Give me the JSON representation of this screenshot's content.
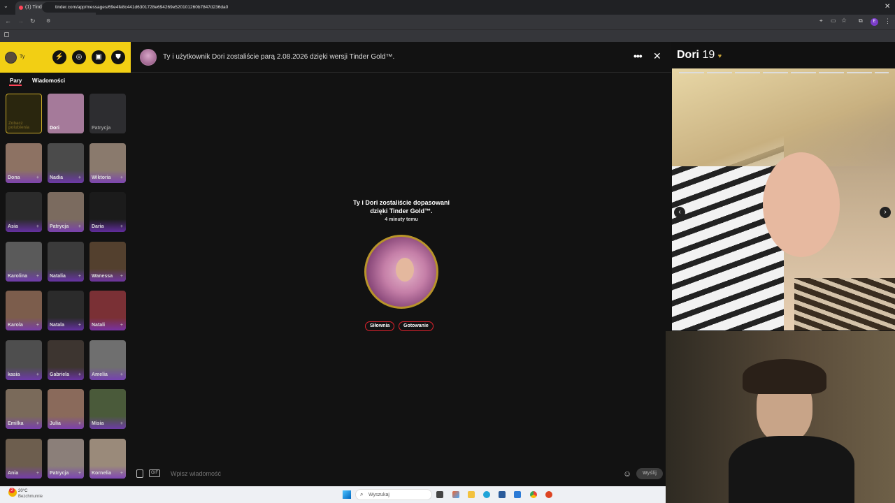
{
  "browser": {
    "tab_title": "(1) Tinder",
    "url": "tinder.com/app/messages/69e4fe8c441d6301728e694269e520101260b7847d236da0"
  },
  "sidebar": {
    "user_label": "Ty",
    "tabs": [
      "Pary",
      "Wiadomości"
    ],
    "matches": [
      {
        "name": "Zobacz polubienia",
        "bg": "#2a260e"
      },
      {
        "name": "Dori",
        "bg": "#a57a9a"
      },
      {
        "name": "Patrycja",
        "bg": "#2d2d30"
      },
      {
        "name": "Dona",
        "bg": "#8d7263"
      },
      {
        "name": "Nadia",
        "bg": "#4b4b4b"
      },
      {
        "name": "Wiktoria",
        "bg": "#8a7a6d"
      },
      {
        "name": "Asia",
        "bg": "#2b2b2b"
      },
      {
        "name": "Patrycja",
        "bg": "#7b6b5f"
      },
      {
        "name": "Daria",
        "bg": "#1b1b1b"
      },
      {
        "name": "Karolina",
        "bg": "#5a5a5a"
      },
      {
        "name": "Natalia",
        "bg": "#3b3b3b"
      },
      {
        "name": "Wanessa",
        "bg": "#53402e"
      },
      {
        "name": "Karola",
        "bg": "#7c5d4c"
      },
      {
        "name": "Natala",
        "bg": "#2b2b2b"
      },
      {
        "name": "Natali",
        "bg": "#7a3035"
      },
      {
        "name": "kasia",
        "bg": "#4e4e4e"
      },
      {
        "name": "Gabriela",
        "bg": "#3d3530"
      },
      {
        "name": "Amelia",
        "bg": "#6f6f6f"
      },
      {
        "name": "Emilka",
        "bg": "#7a6a5a"
      },
      {
        "name": "Julia",
        "bg": "#8a6a5b"
      },
      {
        "name": "Misia",
        "bg": "#4a5a3a"
      },
      {
        "name": "Ania",
        "bg": "#6d5e4e"
      },
      {
        "name": "Patrycja",
        "bg": "#8b7f79"
      },
      {
        "name": "Kornelia",
        "bg": "#9a8a7a"
      }
    ]
  },
  "chat": {
    "header_text": "Ty i użytkownik Dori zostaliście parą 2.08.2026 dzięki wersji Tinder Gold™.",
    "match_you": "Ty i",
    "match_name": "Dori",
    "match_rest": "zostaliście dopasowani",
    "match_line2": "dzięki Tinder Gold™.",
    "match_time": "4 minuty temu",
    "interests": [
      "Siłownia",
      "Gotowanie"
    ],
    "input_placeholder": "Wpisz wiadomość",
    "send_label": "Wyślij",
    "gif_label": "GIF"
  },
  "profile": {
    "name": "Dori",
    "age": "19"
  },
  "taskbar": {
    "temp": "20°C",
    "weather": "Bezchmurnie",
    "search_placeholder": "Wyszukaj",
    "weather_badge": "2"
  },
  "colors": {
    "tinder_gold": "#f2cf14",
    "accent": "#e0222d",
    "gradient_purple": "#7832c8"
  }
}
